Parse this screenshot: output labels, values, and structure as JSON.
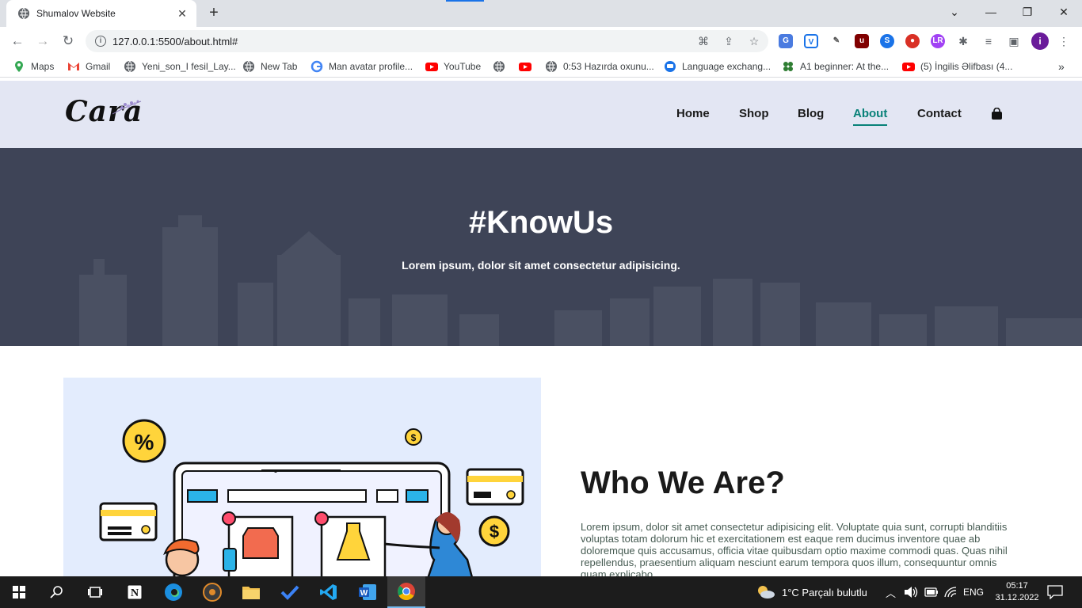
{
  "browser": {
    "tab_title": "Shumalov Website",
    "url": "127.0.0.1:5500/about.html#",
    "bookmarks": [
      {
        "label": "Maps"
      },
      {
        "label": "Gmail"
      },
      {
        "label": "Yeni_son_I fesil_Lay..."
      },
      {
        "label": "New Tab"
      },
      {
        "label": "Man avatar profile..."
      },
      {
        "label": "YouTube"
      },
      {
        "label": "0:53 Hazırda oxunu..."
      },
      {
        "label": "Language exchang..."
      },
      {
        "label": "A1 beginner: At the..."
      },
      {
        "label": "(5) İngilis Əlifbası (4..."
      }
    ],
    "profile_initial": "i"
  },
  "site": {
    "logo": "Cara",
    "nav": {
      "home": "Home",
      "shop": "Shop",
      "blog": "Blog",
      "about": "About",
      "contact": "Contact"
    },
    "hero": {
      "title": "#KnowUs",
      "subtitle": "Lorem ipsum, dolor sit amet consectetur adipisicing."
    },
    "about": {
      "title": "Who We Are?",
      "text": "Lorem ipsum, dolor sit amet consectetur adipisicing elit. Voluptate quia sunt, corrupti blanditiis voluptas totam dolorum hic et exercitationem est eaque rem ducimus inventore quae ab doloremque quis accusamus, officia vitae quibusdam optio maxime commodi quas. Quas nihil repellendus, praesentium aliquam nesciunt earum tempora quos illum, consequuntur omnis quam explicabo."
    }
  },
  "taskbar": {
    "weather": "1°C  Parçalı bulutlu",
    "language": "ENG",
    "time": "05:17",
    "date": "31.12.2022"
  },
  "colors": {
    "accent": "#088178",
    "header_bg": "#e3e6f3",
    "hero_bg": "#3e4457",
    "image_bg": "#e3ecfd"
  }
}
